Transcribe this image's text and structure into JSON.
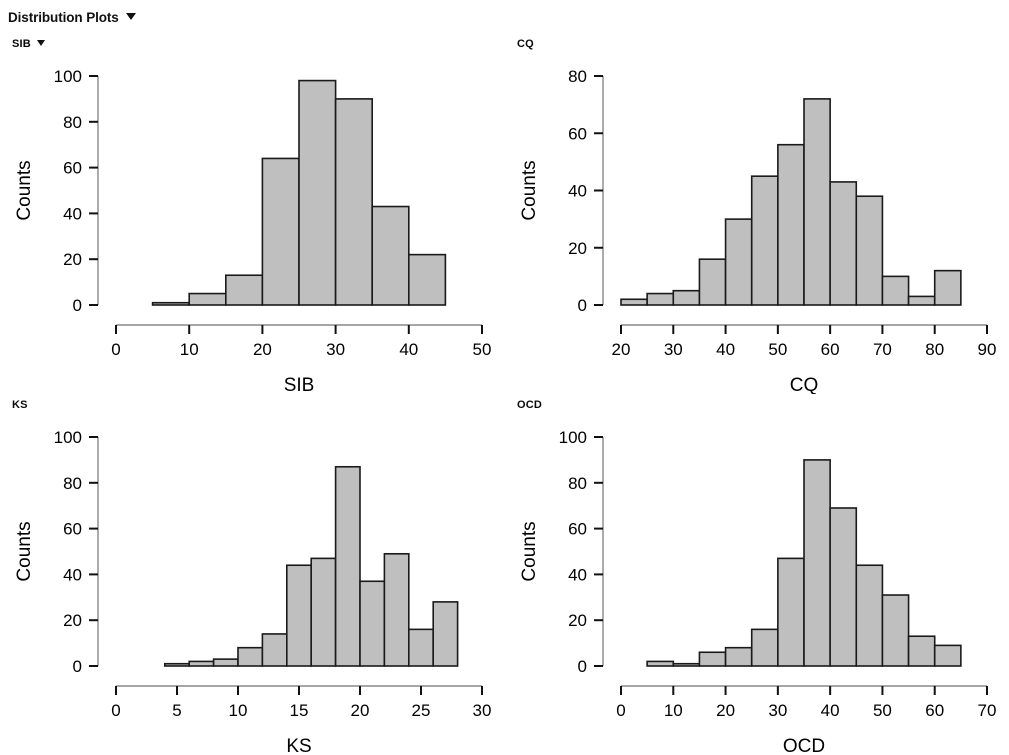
{
  "header": {
    "title": "Distribution Plots",
    "caret_icon": "chevron-down-icon"
  },
  "panels": [
    {
      "id": "sib",
      "label": "SIB",
      "has_caret": true,
      "caret_icon": "chevron-down-icon"
    },
    {
      "id": "cq",
      "label": "CQ",
      "has_caret": false
    },
    {
      "id": "ks",
      "label": "KS",
      "has_caret": false
    },
    {
      "id": "ocd",
      "label": "OCD",
      "has_caret": false
    }
  ],
  "chart_data": [
    {
      "type": "bar",
      "subtype": "histogram",
      "id": "sib",
      "title": "SIB",
      "xlabel": "SIB",
      "ylabel": "Counts",
      "xlim": [
        0,
        50
      ],
      "ylim": [
        0,
        100
      ],
      "xticks": [
        0,
        10,
        20,
        30,
        40,
        50
      ],
      "yticks": [
        0,
        20,
        40,
        60,
        80,
        100
      ],
      "xtick_labels": [
        "0",
        "10",
        "20",
        "30",
        "40",
        "50"
      ],
      "ytick_labels": [
        "0",
        "20",
        "40",
        "60",
        "80",
        "100"
      ],
      "bin_width": 5,
      "bin_edges": [
        5,
        10,
        15,
        20,
        25,
        30,
        35,
        40,
        45
      ],
      "categories": [
        "5-10",
        "10-15",
        "15-20",
        "20-25",
        "25-30",
        "30-35",
        "35-40",
        "40-45"
      ],
      "values": [
        1,
        5,
        13,
        64,
        98,
        90,
        43,
        22
      ],
      "grid": false,
      "legend": "none",
      "bar_fill": "#bfbfbf",
      "bar_stroke": "#1a1a1a"
    },
    {
      "type": "bar",
      "subtype": "histogram",
      "id": "cq",
      "title": "CQ",
      "xlabel": "CQ",
      "ylabel": "Counts",
      "xlim": [
        20,
        90
      ],
      "ylim": [
        0,
        80
      ],
      "xticks": [
        20,
        30,
        40,
        50,
        60,
        70,
        80,
        90
      ],
      "yticks": [
        0,
        20,
        40,
        60,
        80
      ],
      "xtick_labels": [
        "20",
        "30",
        "40",
        "50",
        "60",
        "70",
        "80",
        "90"
      ],
      "ytick_labels": [
        "0",
        "20",
        "40",
        "60",
        "80"
      ],
      "bin_width": 5,
      "bin_edges": [
        20,
        25,
        30,
        35,
        40,
        45,
        50,
        55,
        60,
        65,
        70,
        75,
        80,
        85
      ],
      "categories": [
        "20-25",
        "25-30",
        "30-35",
        "35-40",
        "40-45",
        "45-50",
        "50-55",
        "55-60",
        "60-65",
        "65-70",
        "70-75",
        "75-80",
        "80-85"
      ],
      "values": [
        2,
        4,
        5,
        16,
        30,
        45,
        56,
        72,
        43,
        38,
        10,
        3,
        12
      ],
      "grid": false,
      "legend": "none",
      "bar_fill": "#bfbfbf",
      "bar_stroke": "#1a1a1a"
    },
    {
      "type": "bar",
      "subtype": "histogram",
      "id": "ks",
      "title": "KS",
      "xlabel": "KS",
      "ylabel": "Counts",
      "xlim": [
        0,
        30
      ],
      "ylim": [
        0,
        100
      ],
      "xticks": [
        0,
        5,
        10,
        15,
        20,
        25,
        30
      ],
      "yticks": [
        0,
        20,
        40,
        60,
        80,
        100
      ],
      "xtick_labels": [
        "0",
        "5",
        "10",
        "15",
        "20",
        "25",
        "30"
      ],
      "ytick_labels": [
        "0",
        "20",
        "40",
        "60",
        "80",
        "100"
      ],
      "bin_width": 2,
      "bin_edges": [
        4,
        6,
        8,
        10,
        12,
        14,
        16,
        18,
        20,
        22,
        24,
        26,
        28
      ],
      "categories": [
        "4-6",
        "6-8",
        "8-10",
        "10-12",
        "12-14",
        "14-16",
        "16-18",
        "18-20",
        "20-22",
        "22-24",
        "24-26",
        "26-28"
      ],
      "values": [
        1,
        2,
        3,
        8,
        14,
        44,
        47,
        87,
        37,
        49,
        16,
        28
      ],
      "grid": false,
      "legend": "none",
      "bar_fill": "#bfbfbf",
      "bar_stroke": "#1a1a1a"
    },
    {
      "type": "bar",
      "subtype": "histogram",
      "id": "ocd",
      "title": "OCD",
      "xlabel": "OCD",
      "ylabel": "Counts",
      "xlim": [
        0,
        70
      ],
      "ylim": [
        0,
        100
      ],
      "xticks": [
        0,
        10,
        20,
        30,
        40,
        50,
        60,
        70
      ],
      "yticks": [
        0,
        20,
        40,
        60,
        80,
        100
      ],
      "xtick_labels": [
        "0",
        "10",
        "20",
        "30",
        "40",
        "50",
        "60",
        "70"
      ],
      "ytick_labels": [
        "0",
        "20",
        "40",
        "60",
        "80",
        "100"
      ],
      "bin_width": 5,
      "bin_edges": [
        5,
        10,
        15,
        20,
        25,
        30,
        35,
        40,
        45,
        50,
        55,
        60,
        65
      ],
      "categories": [
        "5-10",
        "10-15",
        "15-20",
        "20-25",
        "25-30",
        "30-35",
        "35-40",
        "40-45",
        "45-50",
        "50-55",
        "55-60",
        "60-65"
      ],
      "values": [
        2,
        1,
        6,
        8,
        16,
        47,
        90,
        69,
        44,
        31,
        13,
        9
      ],
      "grid": false,
      "legend": "none",
      "bar_fill": "#bfbfbf",
      "bar_stroke": "#1a1a1a"
    }
  ]
}
